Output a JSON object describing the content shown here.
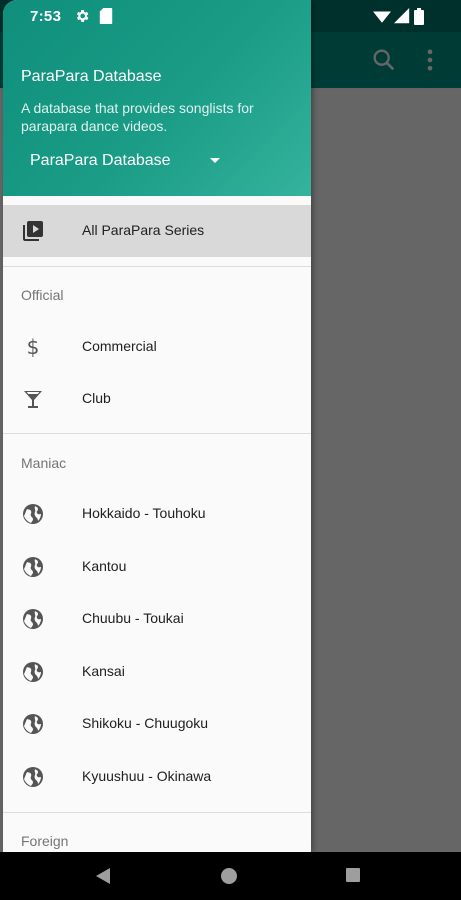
{
  "status_bar": {
    "time": "7:53",
    "icons": [
      "gear-icon",
      "sd-card-icon",
      "wifi-icon",
      "signal-icon",
      "battery-icon"
    ]
  },
  "toolbar": {
    "icons": [
      "search-icon",
      "more-vert-icon"
    ]
  },
  "drawer": {
    "header": {
      "title": "ParaPara Database",
      "subtitle": "A database that provides songlists for parapara dance videos.",
      "dropdown_value": "ParaPara Database"
    },
    "top_item": {
      "label": "All ParaPara Series",
      "icon": "video-library-icon"
    },
    "sections": [
      {
        "title": "Official",
        "items": [
          {
            "label": "Commercial",
            "icon": "dollar-icon"
          },
          {
            "label": "Club",
            "icon": "cocktail-icon"
          }
        ]
      },
      {
        "title": "Maniac",
        "items": [
          {
            "label": "Hokkaido - Touhoku",
            "icon": "globe-icon"
          },
          {
            "label": "Kantou",
            "icon": "globe-icon"
          },
          {
            "label": "Chuubu - Toukai",
            "icon": "globe-icon"
          },
          {
            "label": "Kansai",
            "icon": "globe-icon"
          },
          {
            "label": "Shikoku - Chuugoku",
            "icon": "globe-icon"
          },
          {
            "label": "Kyuushuu - Okinawa",
            "icon": "globe-icon"
          }
        ]
      },
      {
        "title": "Foreign",
        "items": []
      }
    ]
  },
  "colors": {
    "header_teal": "#1a9c86",
    "selected_bg": "#d9d9d9",
    "scrim": "#000000"
  }
}
